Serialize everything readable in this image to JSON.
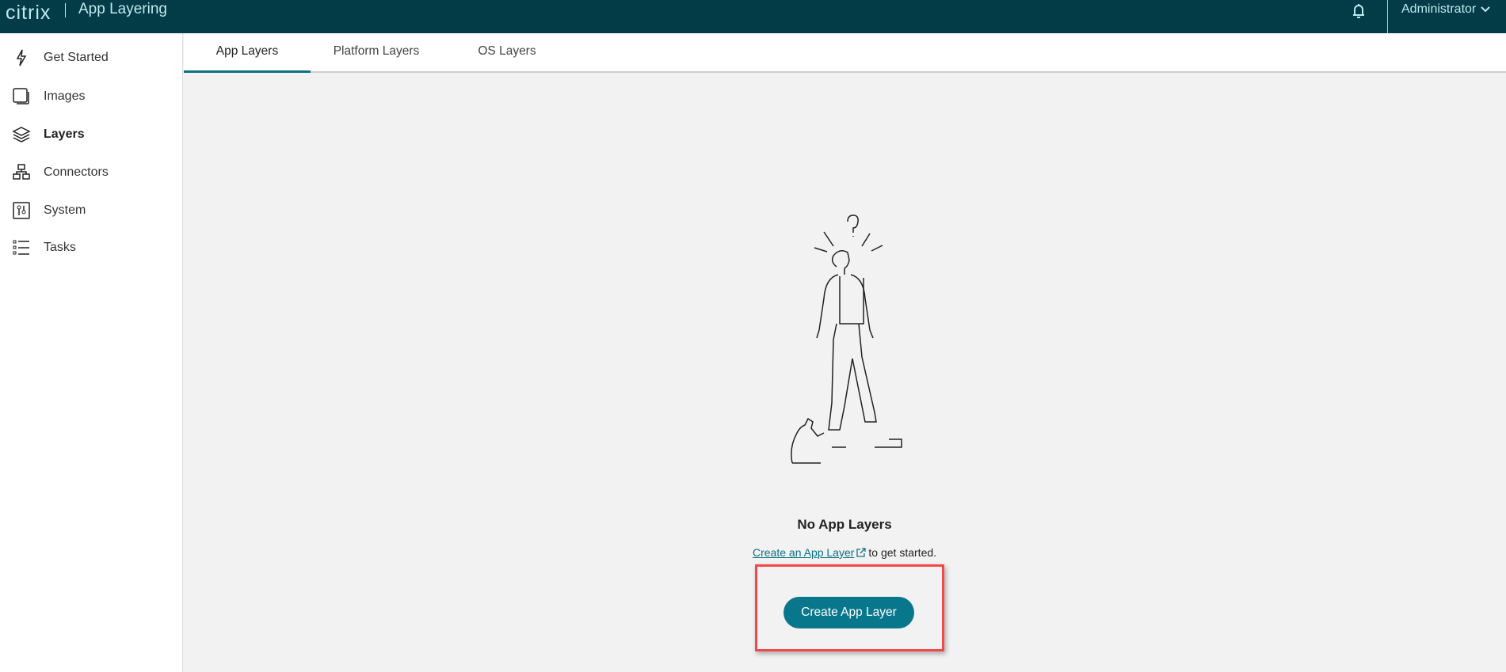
{
  "header": {
    "logo": "citrix",
    "app_title": "App Layering",
    "user": "Administrator"
  },
  "sidebar": {
    "items": [
      {
        "label": "Get Started",
        "icon": "lightning-icon"
      },
      {
        "label": "Images",
        "icon": "images-icon"
      },
      {
        "label": "Layers",
        "icon": "layers-icon",
        "active": true
      },
      {
        "label": "Connectors",
        "icon": "connectors-icon"
      },
      {
        "label": "System",
        "icon": "system-icon"
      },
      {
        "label": "Tasks",
        "icon": "tasks-icon"
      }
    ]
  },
  "tabs": [
    {
      "label": "App Layers",
      "active": true
    },
    {
      "label": "Platform Layers"
    },
    {
      "label": "OS Layers"
    }
  ],
  "empty": {
    "title": "No App Layers",
    "link": "Create an App Layer",
    "suffix": "to get started.",
    "button": "Create App Layer"
  },
  "colors": {
    "header": "#033b47",
    "accent": "#08778c",
    "highlight": "#f24848"
  }
}
